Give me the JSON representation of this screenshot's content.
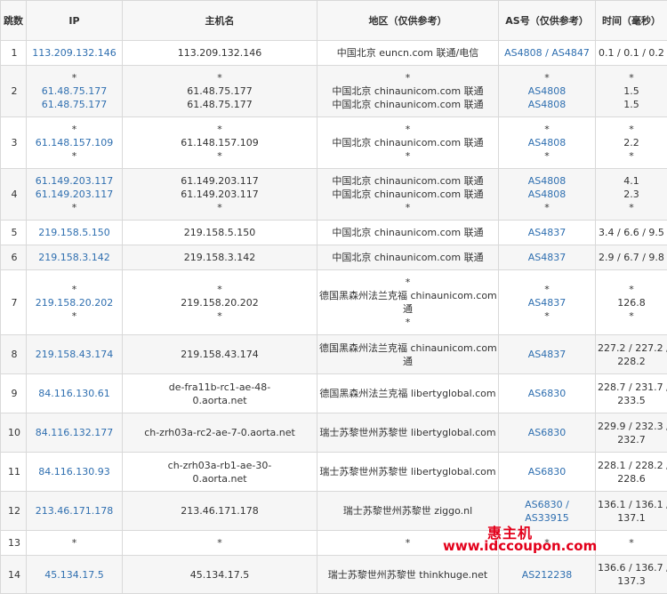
{
  "headers": [
    "跳数",
    "IP",
    "主机名",
    "地区（仅供参考）",
    "AS号（仅供参考）",
    "时间（毫秒）"
  ],
  "rows": [
    {
      "hop": "1",
      "ip": [
        "113.209.132.146"
      ],
      "host": [
        "113.209.132.146"
      ],
      "region": [
        "中国北京 euncn.com 联通/电信"
      ],
      "as": [
        "AS4808 / AS4847"
      ],
      "time": [
        "0.1 / 0.1 / 0.2"
      ]
    },
    {
      "hop": "2",
      "ip": [
        "*",
        "61.48.75.177",
        "61.48.75.177"
      ],
      "host": [
        "*",
        "61.48.75.177",
        "61.48.75.177"
      ],
      "region": [
        "*",
        "中国北京 chinaunicom.com 联通",
        "中国北京 chinaunicom.com 联通"
      ],
      "as": [
        "*",
        "AS4808",
        "AS4808"
      ],
      "time": [
        "*",
        "1.5",
        "1.5"
      ]
    },
    {
      "hop": "3",
      "ip": [
        "*",
        "61.148.157.109",
        "*"
      ],
      "host": [
        "*",
        "61.148.157.109",
        "*"
      ],
      "region": [
        "*",
        "中国北京 chinaunicom.com 联通",
        "*"
      ],
      "as": [
        "*",
        "AS4808",
        "*"
      ],
      "time": [
        "*",
        "2.2",
        "*"
      ]
    },
    {
      "hop": "4",
      "ip": [
        "61.149.203.117",
        "61.149.203.117",
        "*"
      ],
      "host": [
        "61.149.203.117",
        "61.149.203.117",
        "*"
      ],
      "region": [
        "中国北京 chinaunicom.com 联通",
        "中国北京 chinaunicom.com 联通",
        "*"
      ],
      "as": [
        "AS4808",
        "AS4808",
        "*"
      ],
      "time": [
        "4.1",
        "2.3",
        "*"
      ]
    },
    {
      "hop": "5",
      "ip": [
        "219.158.5.150"
      ],
      "host": [
        "219.158.5.150"
      ],
      "region": [
        "中国北京 chinaunicom.com 联通"
      ],
      "as": [
        "AS4837"
      ],
      "time": [
        "3.4 / 6.6 / 9.5"
      ]
    },
    {
      "hop": "6",
      "ip": [
        "219.158.3.142"
      ],
      "host": [
        "219.158.3.142"
      ],
      "region": [
        "中国北京 chinaunicom.com 联通"
      ],
      "as": [
        "AS4837"
      ],
      "time": [
        "2.9 / 6.7 / 9.8"
      ]
    },
    {
      "hop": "7",
      "ip": [
        "*",
        "219.158.20.202",
        "*"
      ],
      "host": [
        "*",
        "219.158.20.202",
        "*"
      ],
      "region": [
        "*",
        "德国黑森州法兰克福 chinaunicom.com 联",
        "通",
        "*"
      ],
      "as": [
        "*",
        "AS4837",
        "*"
      ],
      "time": [
        "*",
        "126.8",
        "*"
      ]
    },
    {
      "hop": "8",
      "ip": [
        "219.158.43.174"
      ],
      "host": [
        "219.158.43.174"
      ],
      "region": [
        "德国黑森州法兰克福 chinaunicom.com 联",
        "通"
      ],
      "as": [
        "AS4837"
      ],
      "time": [
        "227.2 / 227.2 /",
        "228.2"
      ]
    },
    {
      "hop": "9",
      "ip": [
        "84.116.130.61"
      ],
      "host": [
        "de-fra11b-rc1-ae-48-",
        "0.aorta.net"
      ],
      "region": [
        "德国黑森州法兰克福 libertyglobal.com"
      ],
      "as": [
        "AS6830"
      ],
      "time": [
        "228.7 / 231.7 /",
        "233.5"
      ]
    },
    {
      "hop": "10",
      "ip": [
        "84.116.132.177"
      ],
      "host": [
        "ch-zrh03a-rc2-ae-7-0.aorta.net"
      ],
      "region": [
        "瑞士苏黎世州苏黎世 libertyglobal.com"
      ],
      "as": [
        "AS6830"
      ],
      "time": [
        "229.9 / 232.3 /",
        "232.7"
      ]
    },
    {
      "hop": "11",
      "ip": [
        "84.116.130.93"
      ],
      "host": [
        "ch-zrh03a-rb1-ae-30-",
        "0.aorta.net"
      ],
      "region": [
        "瑞士苏黎世州苏黎世 libertyglobal.com"
      ],
      "as": [
        "AS6830"
      ],
      "time": [
        "228.1 / 228.2 /",
        "228.6"
      ]
    },
    {
      "hop": "12",
      "ip": [
        "213.46.171.178"
      ],
      "host": [
        "213.46.171.178"
      ],
      "region": [
        "瑞士苏黎世州苏黎世 ziggo.nl"
      ],
      "as": [
        "AS6830 /",
        "AS33915"
      ],
      "time": [
        "136.1 / 136.1 /",
        "137.1"
      ]
    },
    {
      "hop": "13",
      "ip": [
        "*"
      ],
      "host": [
        "*"
      ],
      "region": [
        "*"
      ],
      "as": [
        "*"
      ],
      "time": [
        "*"
      ]
    },
    {
      "hop": "14",
      "ip": [
        "45.134.17.5"
      ],
      "host": [
        "45.134.17.5"
      ],
      "region": [
        "瑞士苏黎世州苏黎世 thinkhuge.net"
      ],
      "as": [
        "AS212238"
      ],
      "time": [
        "136.6 / 136.7 /",
        "137.3"
      ]
    }
  ],
  "row_heights": [
    28,
    58,
    58,
    58,
    28,
    28,
    73,
    44,
    44,
    44,
    44,
    44,
    28,
    43
  ],
  "watermark": {
    "brand": "惠主机",
    "url": "www.idccoupon.com"
  },
  "colors": {
    "link": "#2f6fb0",
    "watermark": "#e3001b"
  }
}
